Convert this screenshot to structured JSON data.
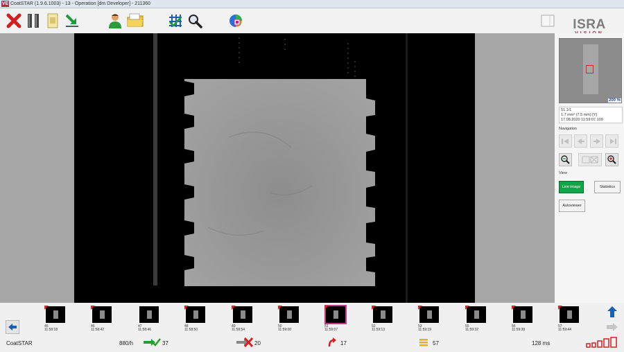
{
  "window": {
    "title": "CoatSTAR (1.9.6.1003) - 13 - Operation [dm Developer] - 211360",
    "app_icon": "VE"
  },
  "logo": {
    "line1": "ISRA",
    "line2": "VISION"
  },
  "toolbar": [
    {
      "name": "close-icon"
    },
    {
      "name": "pause-icon"
    },
    {
      "name": "document-icon"
    },
    {
      "name": "arrow-download-icon"
    },
    {
      "name": "user-icon"
    },
    {
      "name": "folder-open-icon"
    },
    {
      "name": "grid-icon"
    },
    {
      "name": "zoom-icon"
    },
    {
      "name": "color-calibration-icon"
    },
    {
      "name": "panel-toggle-icon"
    }
  ],
  "sidebar": {
    "preview_zoom": "200 %",
    "info": [
      "51.1/1",
      "1.7 mm² (7.5 mm) [Y]",
      "17.08.2020 11:59:07.109"
    ],
    "navigation_label": "Navigation",
    "view_label": "View",
    "live_image_label": "Live image",
    "statistics_label": "Statistics",
    "autoviewer_label": "Autoviewer"
  },
  "thumbnails": [
    {
      "n": "45",
      "time": "11:58:18",
      "mark": true
    },
    {
      "n": "46",
      "time": "11:58:42",
      "mark": true
    },
    {
      "n": "47",
      "time": "11:58:46",
      "mark": false
    },
    {
      "n": "48",
      "time": "11:58:50",
      "mark": true
    },
    {
      "n": "49",
      "time": "11:58:54",
      "mark": true
    },
    {
      "n": "50",
      "time": "11:59:00",
      "mark": true
    },
    {
      "n": "51",
      "time": "11:59:07",
      "mark": true,
      "selected": true
    },
    {
      "n": "52",
      "time": "11:59:13",
      "mark": true
    },
    {
      "n": "53",
      "time": "11:59:19",
      "mark": true
    },
    {
      "n": "55",
      "time": "11:59:32",
      "mark": true
    },
    {
      "n": "56",
      "time": "11:59:38",
      "mark": true
    },
    {
      "n": "57",
      "time": "11:59:44",
      "mark": true
    }
  ],
  "status": {
    "app": "CoatSTAR",
    "rate": "880/h",
    "ok_count": "37",
    "nok_count": "20",
    "redo_count": "17",
    "stack_count": "57",
    "cycle_time": "128 ms"
  },
  "colors": {
    "ok": "#2b9e2b",
    "nok": "#d42020",
    "selected": "#c43a8a",
    "live_button": "#0fa64a",
    "logo_red": "#c0282a"
  }
}
